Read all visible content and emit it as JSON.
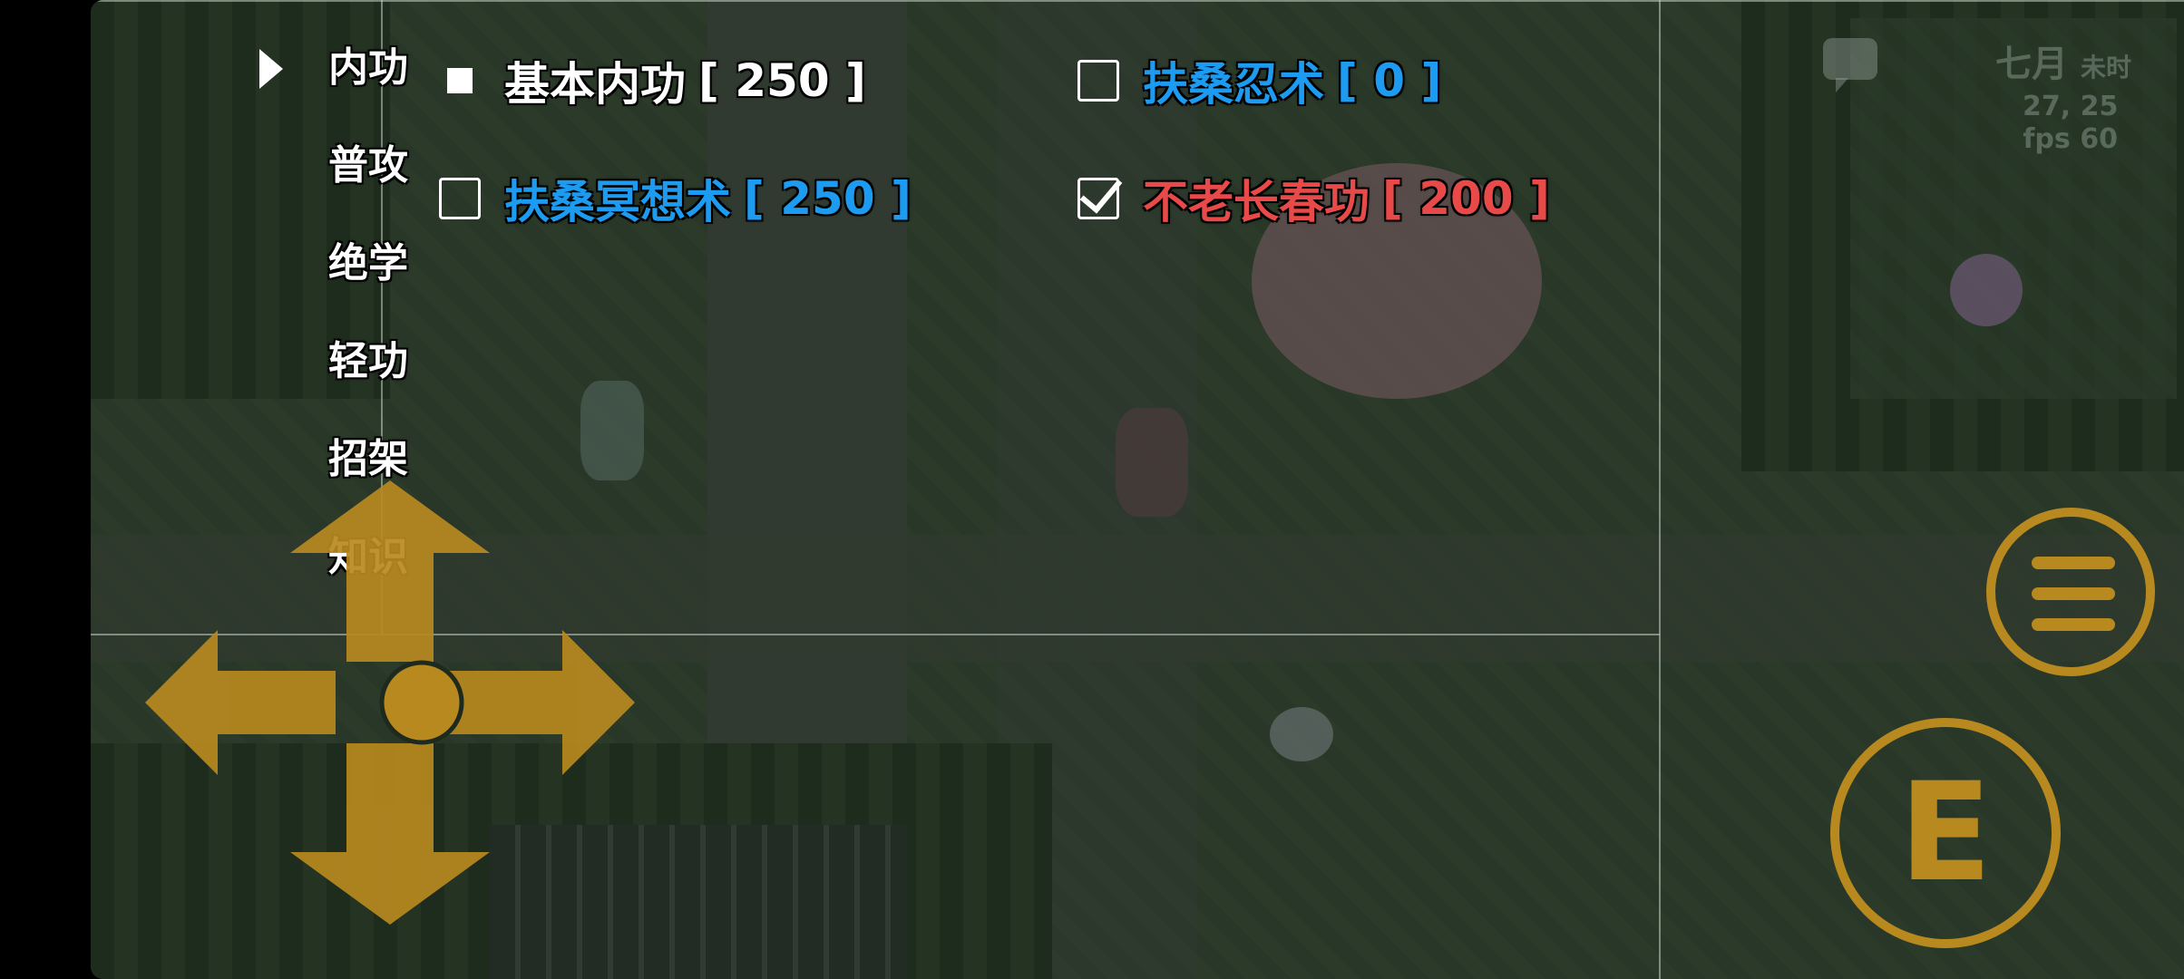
{
  "menu": {
    "items": [
      {
        "label": "内功",
        "selected": true
      },
      {
        "label": "普攻"
      },
      {
        "label": "绝学"
      },
      {
        "label": "轻功"
      },
      {
        "label": "招架"
      },
      {
        "label": "知识"
      }
    ]
  },
  "skills": [
    {
      "name": "基本内功",
      "value": "[ 250 ]",
      "state": "filled",
      "color": "#ffffff"
    },
    {
      "name": "扶桑忍术",
      "value": "[ 0 ]",
      "state": "unchecked",
      "color": "#1d9bf0"
    },
    {
      "name": "扶桑冥想术",
      "value": "[ 250 ]",
      "state": "unchecked",
      "color": "#1d9bf0"
    },
    {
      "name": "不老长春功",
      "value": "[ 200 ]",
      "state": "checked",
      "color": "#e84a4a"
    }
  ],
  "hud": {
    "month": "七月",
    "time": "未时",
    "coords": "27, 25",
    "fps": "fps 60"
  },
  "controls": {
    "menu_button": "menu-icon",
    "action_button": "E",
    "dpad": "dpad-arrows"
  },
  "colors": {
    "accent": "#b8891f",
    "blue": "#1d9bf0",
    "red": "#e84a4a"
  }
}
